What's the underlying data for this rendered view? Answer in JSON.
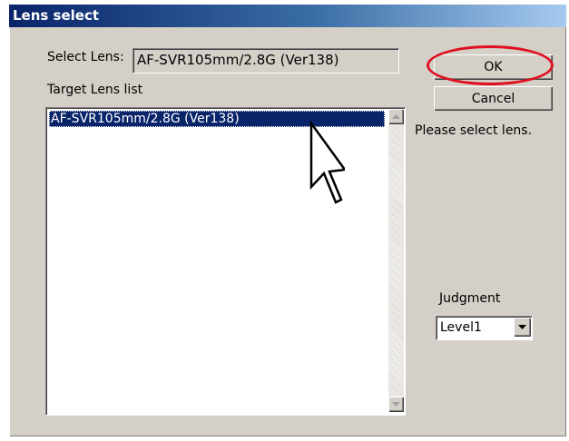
{
  "window": {
    "title": "Lens select"
  },
  "select_lens": {
    "label": "Select Lens:",
    "value": "AF-SVR105mm/2.8G (Ver138)"
  },
  "target_list": {
    "label": "Target Lens list",
    "items": [
      "AF-SVR105mm/2.8G (Ver138)"
    ],
    "selected_index": 0
  },
  "buttons": {
    "ok": "OK",
    "cancel": "Cancel"
  },
  "status": {
    "message": "Please select lens."
  },
  "judgment": {
    "label": "Judgment",
    "selected": "Level1"
  },
  "icons": {
    "scroll_up": "scroll-up-arrow-icon",
    "scroll_down": "scroll-down-arrow-icon",
    "dropdown": "chevron-down-icon",
    "cursor": "mouse-pointer-icon"
  },
  "colors": {
    "titlebar": "#0a246a",
    "selection": "#0a246a",
    "highlight_ring": "#e01020",
    "face": "#d4d0c8"
  }
}
